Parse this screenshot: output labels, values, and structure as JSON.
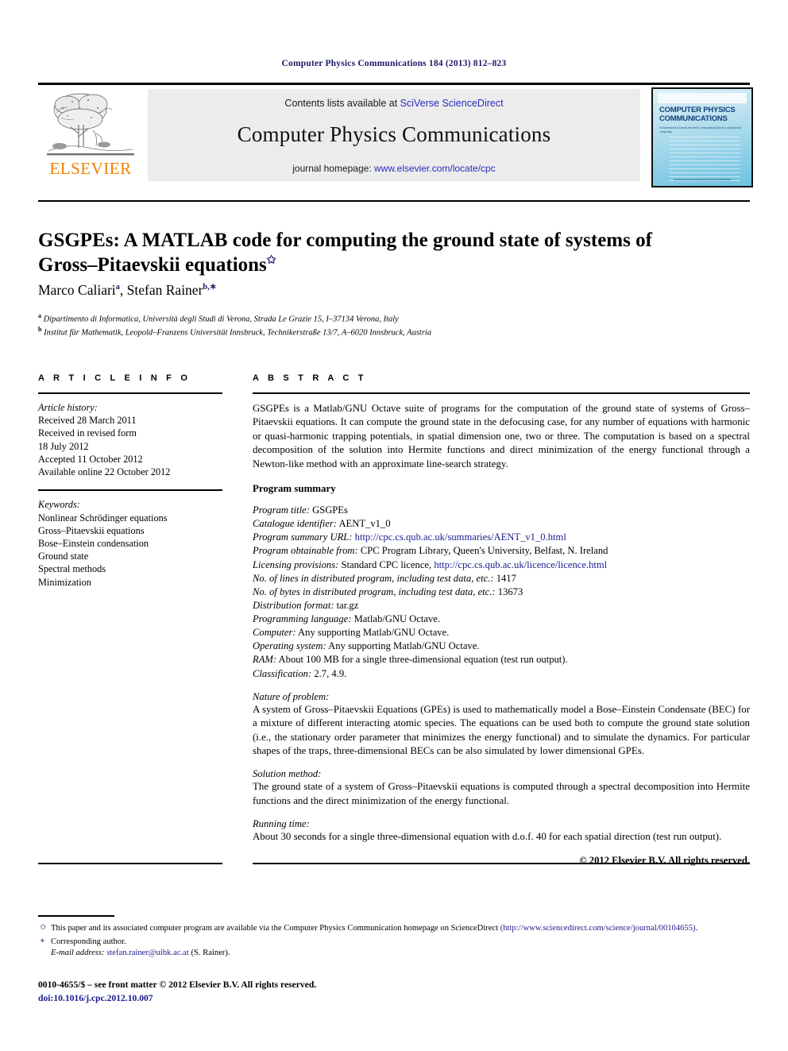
{
  "running_head": "Computer Physics Communications 184 (2013) 812–823",
  "masthead": {
    "publisher_name": "ELSEVIER",
    "contents_prefix": "Contents lists available at ",
    "contents_link": "SciVerse ScienceDirect",
    "journal_title": "Computer Physics Communications",
    "homepage_prefix": "journal homepage: ",
    "homepage_link": "www.elsevier.com/locate/cpc",
    "cover_title": "COMPUTER PHYSICS COMMUNICATIONS",
    "cover_subtitle": "An International Journal devoted to computational physics and physical computing"
  },
  "article": {
    "title": "GSGPEs: A MATLAB code for computing the ground state of systems of Gross–Pitaevskii equations",
    "title_footnote_mark": "✩",
    "authors_plain": "Marco Caliari",
    "author1": "Marco Caliari",
    "author1_sup": "a",
    "author2": "Stefan Rainer",
    "author2_sup": "b,∗",
    "affiliation_a_mark": "a",
    "affiliation_a": "Dipartimento di Informatica, Università degli Studi di Verona, Strada Le Grazie 15, I–37134 Verona, Italy",
    "affiliation_b_mark": "b",
    "affiliation_b": "Institut für Mathematik, Leopold–Franzens Universität Innsbruck, Technikerstraße 13/7, A–6020 Innsbruck, Austria"
  },
  "article_info": {
    "heading": "A R T I C L E  I N F O",
    "history_label": "Article history:",
    "history": [
      "Received 28 March 2011",
      "Received in revised form",
      "18 July 2012",
      "Accepted 11 October 2012",
      "Available online 22 October 2012"
    ],
    "keywords_label": "Keywords:",
    "keywords": [
      "Nonlinear Schrödinger equations",
      "Gross–Pitaevskii equations",
      "Bose–Einstein condensation",
      "Ground state",
      "Spectral methods",
      "Minimization"
    ]
  },
  "abstract": {
    "heading": "A B S T R A C T",
    "text": "GSGPEs is a Matlab/GNU Octave suite of programs for the computation of the ground state of systems of Gross–Pitaevskii equations. It can compute the ground state in the defocusing case, for any number of equations with harmonic or quasi-harmonic trapping potentials, in spatial dimension one, two or three. The computation is based on a spectral decomposition of the solution into Hermite functions and direct minimization of the energy functional through a Newton-like method with an approximate line-search strategy.",
    "program_summary_heading": "Program summary",
    "fields": [
      {
        "key": "Program title:",
        "value": "GSGPEs"
      },
      {
        "key": "Catalogue identifier:",
        "value": "AENT_v1_0"
      },
      {
        "key": "Program summary URL:",
        "value": "http://cpc.cs.qub.ac.uk/summaries/AENT_v1_0.html",
        "link": true
      },
      {
        "key": "Program obtainable from:",
        "value": "CPC Program Library, Queen's University, Belfast, N. Ireland"
      },
      {
        "key": "Licensing provisions:",
        "value": "Standard CPC licence, ",
        "link_text": "http://cpc.cs.qub.ac.uk/licence/licence.html"
      },
      {
        "key": "No. of lines in distributed program, including test data, etc.:",
        "value": "1417"
      },
      {
        "key": "No. of bytes in distributed program, including test data, etc.:",
        "value": "13673"
      },
      {
        "key": "Distribution format:",
        "value": "tar.gz"
      },
      {
        "key": "Programming language:",
        "value": "Matlab/GNU Octave."
      },
      {
        "key": "Computer:",
        "value": "Any supporting Matlab/GNU Octave."
      },
      {
        "key": "Operating system:",
        "value": "Any supporting Matlab/GNU Octave."
      },
      {
        "key": "RAM:",
        "value": "About 100 MB for a single three-dimensional equation (test run output)."
      },
      {
        "key": "Classification:",
        "value": "2.7, 4.9."
      }
    ],
    "nature_label": "Nature of problem:",
    "nature_text": "A system of Gross–Pitaevskii Equations (GPEs) is used to mathematically model a Bose–Einstein Condensate (BEC) for a mixture of different interacting atomic species. The equations can be used both to compute the ground state solution (i.e., the stationary order parameter that minimizes the energy functional) and to simulate the dynamics. For particular shapes of the traps, three-dimensional BECs can be also simulated by lower dimensional GPEs.",
    "solution_label": "Solution method:",
    "solution_text": "The ground state of a system of Gross–Pitaevskii equations is computed through a spectral decomposition into Hermite functions and the direct minimization of the energy functional.",
    "running_label": "Running time:",
    "running_text": "About 30 seconds for a single three-dimensional equation with d.o.f. 40 for each spatial direction (test run output).",
    "copyright": "© 2012 Elsevier B.V. All rights reserved."
  },
  "footnotes": {
    "star_mark": "✩",
    "star_text": "This paper and its associated computer program are available via the Computer Physics Communication homepage on ScienceDirect",
    "star_link": "(http://www.sciencedirect.com/science/journal/00104655)",
    "star_link_tail": ".",
    "corr_mark": "∗",
    "corr_text": "Corresponding author.",
    "email_label": "E-mail address:",
    "email_link": "stefan.rainer@uibk.ac.at",
    "email_tail": " (S. Rainer)."
  },
  "imprint": {
    "line1": "0010-4655/$ – see front matter © 2012 Elsevier B.V. All rights reserved.",
    "doi": "doi:10.1016/j.cpc.2012.10.007"
  },
  "colors": {
    "link": "#1b1b8f",
    "elsevier_orange": "#f08000",
    "banner_bg": "#ececec",
    "runhead": "#1a1a66"
  }
}
